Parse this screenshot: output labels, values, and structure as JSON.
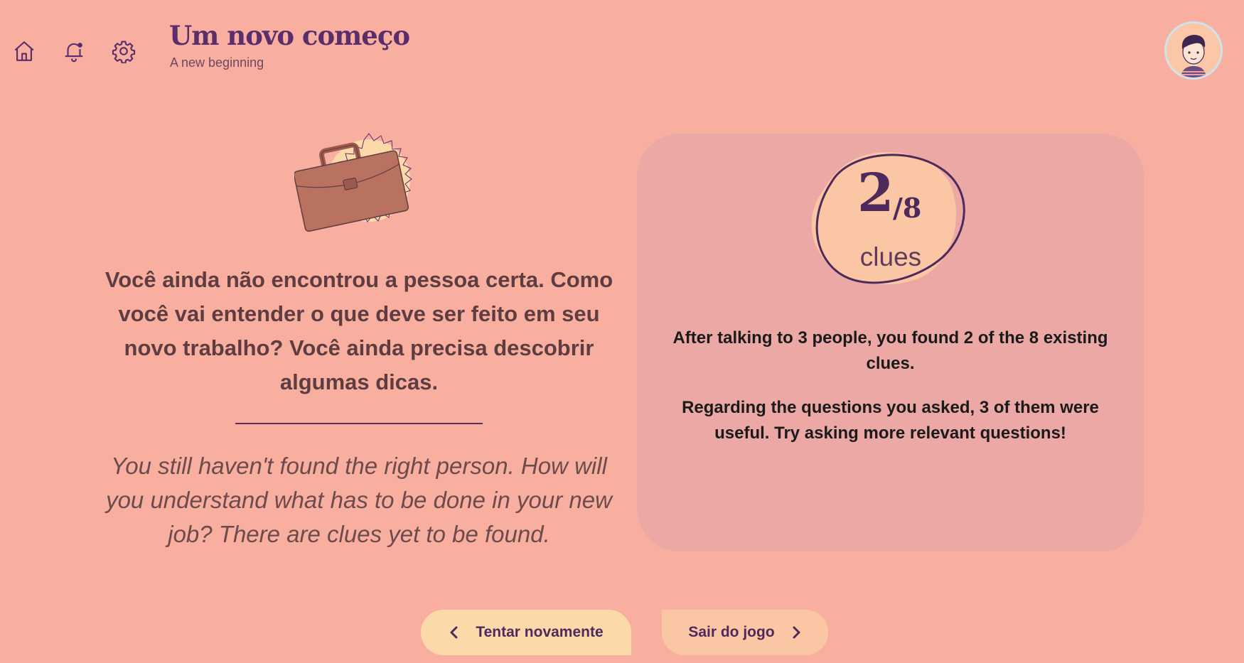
{
  "header": {
    "title": "Um novo começo",
    "subtitle": "A new beginning",
    "icons": [
      "home-icon",
      "bell-icon",
      "gear-icon"
    ]
  },
  "user": {
    "avatar": "avatar-icon"
  },
  "result": {
    "illustration": "briefcase-icon",
    "message_pt": "Você ainda não encontrou a pessoa certa. Como você vai entender o que deve ser feito em seu novo trabalho? Você ainda precisa descobrir algumas dicas.",
    "message_en": "You still haven't found the right person. How will you understand what has to be done in your new job? There are clues yet to be found."
  },
  "summary": {
    "clues_found": "2",
    "clues_total": "/8",
    "clues_label": "clues",
    "text_1": "After talking to 3 people, you found 2 of the 8 existing clues.",
    "text_2": "Regarding the questions you asked, 3 of them were useful. Try asking more relevant questions!"
  },
  "actions": {
    "retry_label": "Tentar novamente",
    "exit_label": "Sair do jogo"
  },
  "colors": {
    "background": "#f9afa0",
    "card": "#eba8a4",
    "accent": "#5a2d6b",
    "badge": "#fbc6a4",
    "retry_button": "#fbd9a9",
    "exit_button": "#fbc6a4"
  }
}
